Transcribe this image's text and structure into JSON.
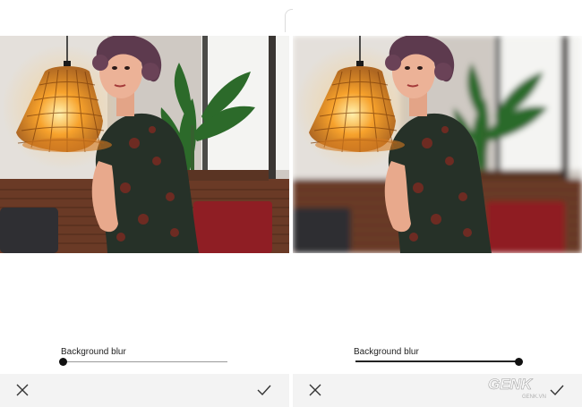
{
  "panels": [
    {
      "slider": {
        "label": "Background blur",
        "value": 0.0
      },
      "actions": {
        "cancel_icon": "close-icon",
        "confirm_icon": "check-icon"
      }
    },
    {
      "slider": {
        "label": "Background blur",
        "value": 1.0
      },
      "actions": {
        "cancel_icon": "close-icon",
        "confirm_icon": "check-icon"
      }
    }
  ],
  "watermark": {
    "text": "GENK",
    "sub": "GENK.VN",
    "icon": "genk-logo"
  },
  "colors": {
    "accent": "#222222",
    "toolbar": "#f3f3f3",
    "lamp": "#f7a22c"
  }
}
